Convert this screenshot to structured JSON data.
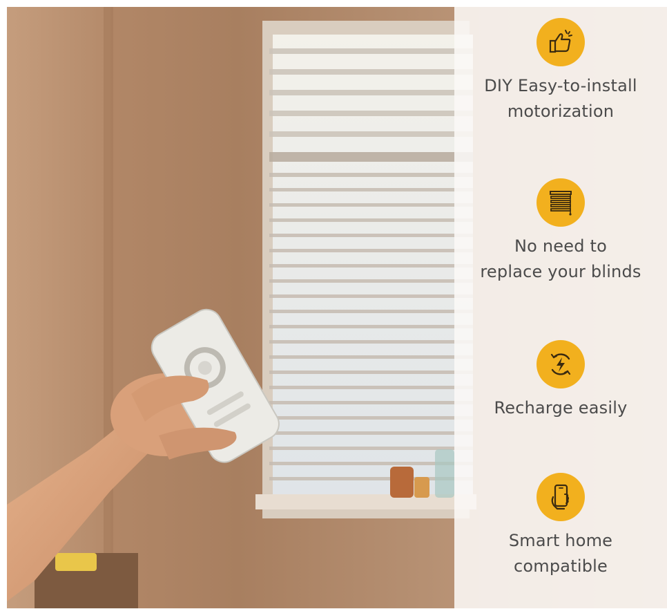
{
  "colors": {
    "accent": "#f2b01e",
    "text": "#4b4b4b",
    "panel": "#faf8f6"
  },
  "features": [
    {
      "icon": "thumbs-up-icon",
      "line1": "DIY Easy-to-install",
      "line2": "motorization"
    },
    {
      "icon": "blinds-icon",
      "line1": "No need to",
      "line2": "replace your blinds"
    },
    {
      "icon": "recharge-icon",
      "line1": "Recharge easily",
      "line2": ""
    },
    {
      "icon": "smartphone-icon",
      "line1": "Smart home",
      "line2": "compatible"
    }
  ]
}
